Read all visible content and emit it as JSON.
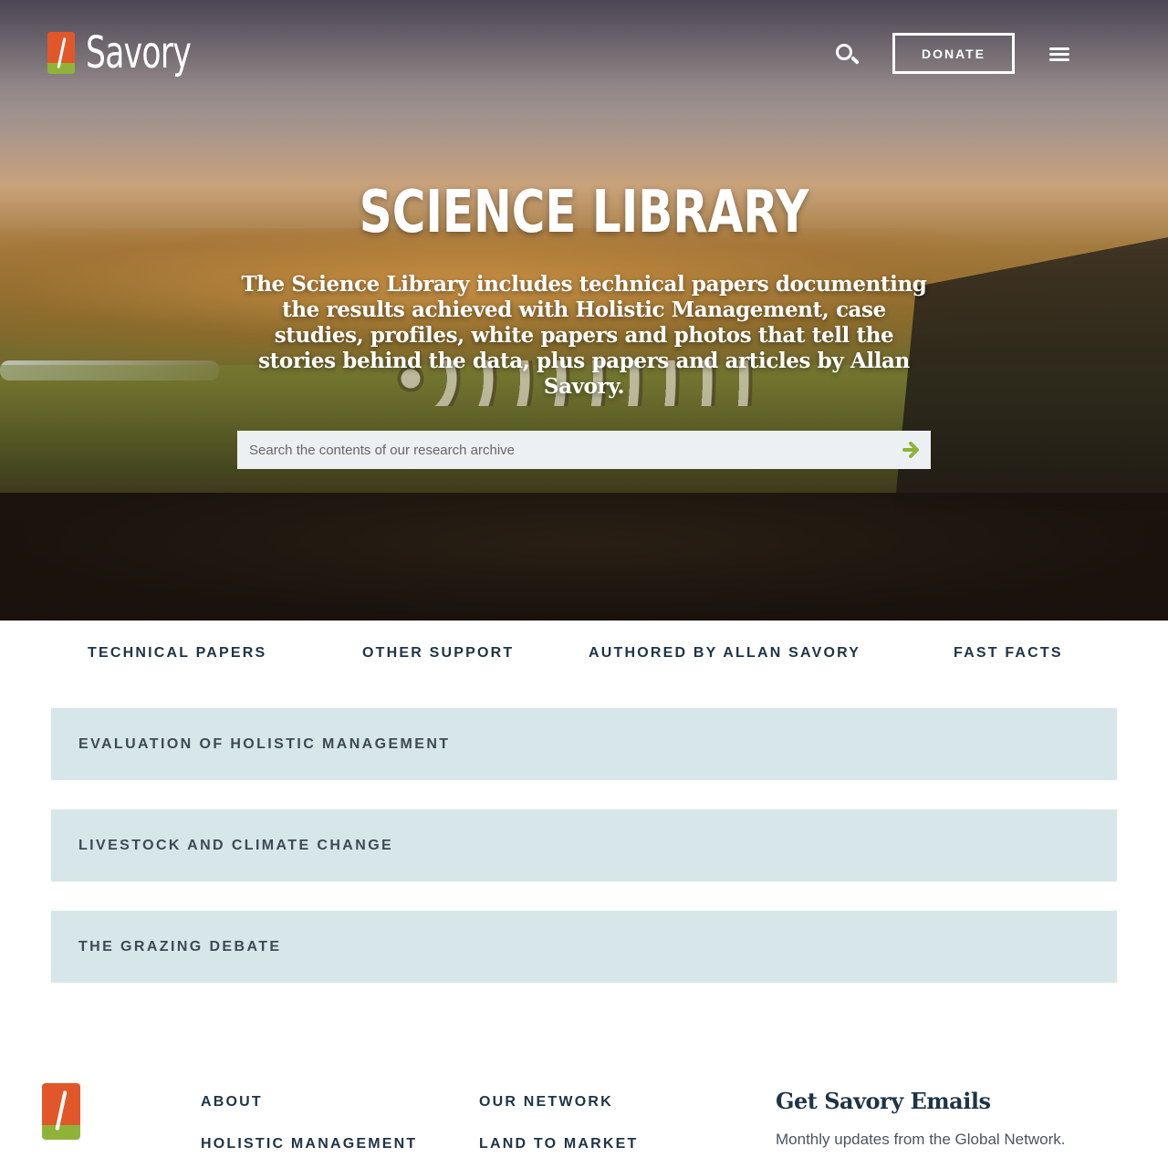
{
  "header": {
    "logo_text": "Savory",
    "donate_label": "DONATE"
  },
  "hero": {
    "title": "SCIENCE LIBRARY",
    "description": "The Science Library includes technical papers documenting the results achieved with Holistic Management, case studies, profiles, white papers and photos that tell the stories behind the data, plus papers and articles by Allan Savory.",
    "search": {
      "placeholder": "Search the contents of our research archive",
      "value": ""
    }
  },
  "tabs": [
    {
      "label": "TECHNICAL PAPERS"
    },
    {
      "label": "OTHER SUPPORT"
    },
    {
      "label": "AUTHORED BY ALLAN SAVORY"
    },
    {
      "label": "FAST FACTS"
    }
  ],
  "accordion": [
    {
      "label": "EVALUATION OF HOLISTIC MANAGEMENT"
    },
    {
      "label": "LIVESTOCK AND CLIMATE CHANGE"
    },
    {
      "label": "THE GRAZING DEBATE"
    }
  ],
  "footer": {
    "col1": [
      {
        "label": "ABOUT"
      },
      {
        "label": "HOLISTIC MANAGEMENT"
      }
    ],
    "col2": [
      {
        "label": "OUR NETWORK"
      },
      {
        "label": "LAND TO MARKET"
      }
    ],
    "signup_heading": "Get Savory Emails",
    "signup_sub": "Monthly updates from the Global Network."
  },
  "colors": {
    "brand_orange": "#e2572a",
    "brand_green": "#8fb339",
    "navy_text": "#1e3446",
    "accordion_bg": "#d7e6e9"
  },
  "icons": {
    "search": "search-icon",
    "menu": "hamburger-menu-icon",
    "submit": "arrow-right-icon"
  }
}
